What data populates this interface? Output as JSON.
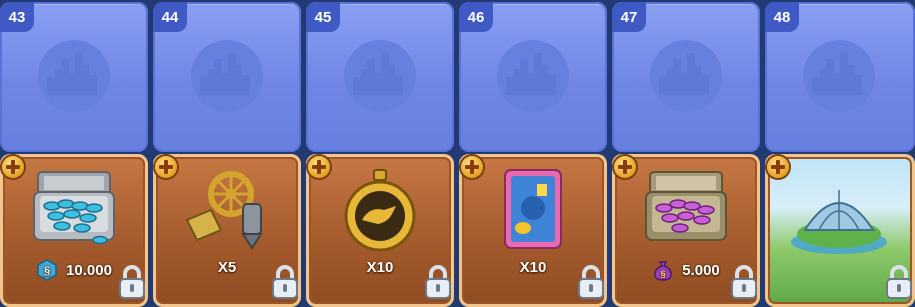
{
  "slots": [
    {
      "number": "43",
      "reward_label": "10.000",
      "reward_icon": "blue-coins-briefcase-icon",
      "currency_icon": "simcash-icon"
    },
    {
      "number": "44",
      "reward_label": "X5",
      "reward_icon": "excavator-tool-icon",
      "currency_icon": ""
    },
    {
      "number": "45",
      "reward_label": "X10",
      "reward_icon": "panther-stopwatch-icon",
      "currency_icon": ""
    },
    {
      "number": "46",
      "reward_label": "X10",
      "reward_icon": "trading-card-icon",
      "currency_icon": ""
    },
    {
      "number": "47",
      "reward_label": "5.000",
      "reward_icon": "purple-coins-briefcase-icon",
      "currency_icon": "purple-money-bag-icon"
    },
    {
      "number": "48",
      "reward_label": "",
      "reward_icon": "dome-building-image",
      "currency_icon": ""
    }
  ],
  "colors": {
    "background": "#223a73",
    "top_card": "#7189e6",
    "badge": "#3f5ac4",
    "bottom_card": "#a35a2c",
    "bottom_border": "#f1c58d"
  },
  "icons": {
    "top": "city-skyline-icon",
    "add": "plus-icon",
    "locked": "lock-icon"
  }
}
